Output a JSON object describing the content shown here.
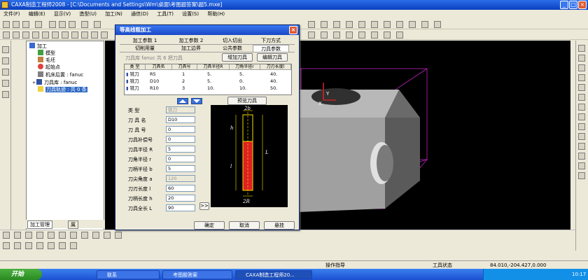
{
  "window": {
    "title": "CAXA制造工程师2008 - [C:\\Documents and Settings\\Wm\\桌面\\考图题答案\\题5.mxe]"
  },
  "menu": [
    "文件(F)",
    "编辑(E)",
    "显示(V)",
    "造型(U)",
    "加工(N)",
    "通信(D)",
    "工具(T)",
    "设置(S)",
    "帮助(H)"
  ],
  "tree": {
    "items": [
      {
        "label": "加工",
        "level": 0
      },
      {
        "label": "模型",
        "level": 1
      },
      {
        "label": "毛坯",
        "level": 1
      },
      {
        "label": "起始点",
        "level": 1
      },
      {
        "label": "机床后置 : fanuc",
        "level": 1
      },
      {
        "label": "刀具库 : fanuc",
        "level": 1
      },
      {
        "label": "刀具轨迹 : 共 0 条",
        "level": 1,
        "selected": true
      }
    ],
    "tabs": [
      "加工管理",
      "属"
    ]
  },
  "dialog": {
    "title": "等高线粗加工",
    "tabs_row1": [
      "加工参数 1",
      "加工参数 2",
      "切入切出",
      "下刀方式"
    ],
    "tabs_row2": [
      "切削用量",
      "加工边界",
      "公共参数",
      "刀具参数"
    ],
    "tool_lib_label": "刀具库 fanuc   共 6 把刀具",
    "add_tool": "增加刀具",
    "edit_tool": "编辑刀具",
    "table": {
      "headers": [
        "类 型",
        "刀具名",
        "刀具号",
        "刀具半径R",
        "刀角半径r",
        "刀刃长度l"
      ],
      "rows": [
        [
          "铣刀",
          "R5",
          "1",
          "5.",
          "5.",
          "40."
        ],
        [
          "铣刀",
          "D10",
          "2",
          "5.",
          "0.",
          "40."
        ],
        [
          "铣刀",
          "R10",
          "3",
          "10.",
          "10.",
          "50."
        ]
      ]
    },
    "preview_tool": "预览刀具",
    "fields": [
      {
        "label": "类    型",
        "value": "铣刀"
      },
      {
        "label": "刀 具 名",
        "value": "D10"
      },
      {
        "label": "刀 具 号",
        "value": "0"
      },
      {
        "label": "刀具补偿号",
        "value": "0"
      },
      {
        "label": "刀具半径 R",
        "value": "5"
      },
      {
        "label": "刀角半径 r",
        "value": "0"
      },
      {
        "label": "刀柄半径 b",
        "value": "5"
      },
      {
        "label": "刀尖角度 a",
        "value": "120"
      },
      {
        "label": "刀刃长度 l",
        "value": "60"
      },
      {
        "label": "刀柄长度 h",
        "value": "20"
      },
      {
        "label": "刀具全长 L",
        "value": "90"
      }
    ],
    "more_btn": ">>",
    "diagram": {
      "b": "2b",
      "h": "h",
      "l": "l",
      "L": "L",
      "R": "2R"
    },
    "ok": "确定",
    "cancel": "取消",
    "hang": "悬挂"
  },
  "status": {
    "prompt": "操作指导",
    "tool_state": "工具状态",
    "coords": "84.010,-204.427,0.000"
  },
  "taskbar": {
    "start": "开始",
    "items": [
      "联系",
      "考图题答案",
      "CAXA制造工程师20..."
    ],
    "time": "10:17"
  },
  "colors": {
    "titlebar": "#0b3fc0",
    "dialog_bg": "#ece9d8",
    "tool_red": "#e02020",
    "tool_yellow": "#f0e000",
    "selection": "#316ac5"
  }
}
